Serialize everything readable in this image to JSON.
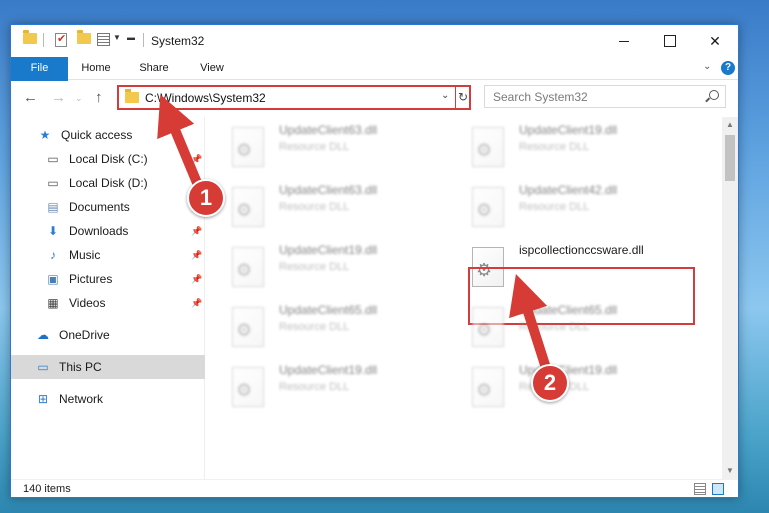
{
  "window": {
    "title": "System32",
    "controls": [
      "minimize",
      "maximize",
      "close"
    ]
  },
  "ribbon": {
    "tabs": [
      "File",
      "Home",
      "Share",
      "View"
    ],
    "help_label": "?"
  },
  "navbar": {
    "address": "C:\\Windows\\System32",
    "search_placeholder": "Search System32"
  },
  "sidebar": {
    "items": [
      {
        "label": "Quick access",
        "icon": "star-icon",
        "pinned": false
      },
      {
        "label": "Local Disk (C:)",
        "icon": "drive-icon",
        "pinned": true
      },
      {
        "label": "Local Disk (D:)",
        "icon": "drive-icon",
        "pinned": false
      },
      {
        "label": "Documents",
        "icon": "document-icon",
        "pinned": true
      },
      {
        "label": "Downloads",
        "icon": "download-icon",
        "pinned": true
      },
      {
        "label": "Music",
        "icon": "music-icon",
        "pinned": true
      },
      {
        "label": "Pictures",
        "icon": "pictures-icon",
        "pinned": true
      },
      {
        "label": "Videos",
        "icon": "video-icon",
        "pinned": true
      },
      {
        "label": "OneDrive",
        "icon": "cloud-icon",
        "pinned": false
      },
      {
        "label": "This PC",
        "icon": "computer-icon",
        "pinned": false,
        "selected": true
      },
      {
        "label": "Network",
        "icon": "network-icon",
        "pinned": false
      }
    ]
  },
  "files": [
    {
      "name": "UpdateClient63.dll",
      "type": "Resource DLL"
    },
    {
      "name": "UpdateClient19.dll",
      "type": "Resource DLL"
    },
    {
      "name": "UpdateClient63.dll",
      "type": "Resource DLL"
    },
    {
      "name": "UpdateClient42.dll",
      "type": "Resource DLL"
    },
    {
      "name": "UpdateClient19.dll",
      "type": "Resource DLL"
    },
    {
      "name": "ispcollectionccsware.dll",
      "type": ""
    },
    {
      "name": "UpdateClient65.dll",
      "type": "Resource DLL"
    },
    {
      "name": "UpdateClient65.dll",
      "type": "Resource DLL"
    },
    {
      "name": "UpdateClient19.dll",
      "type": "Resource DLL"
    },
    {
      "name": "UpdateClient19.dll",
      "type": "Resource DLL"
    }
  ],
  "status": {
    "item_count": "140 items"
  },
  "annotations": {
    "step1": "1",
    "step2": "2",
    "color": "#d63b35"
  }
}
